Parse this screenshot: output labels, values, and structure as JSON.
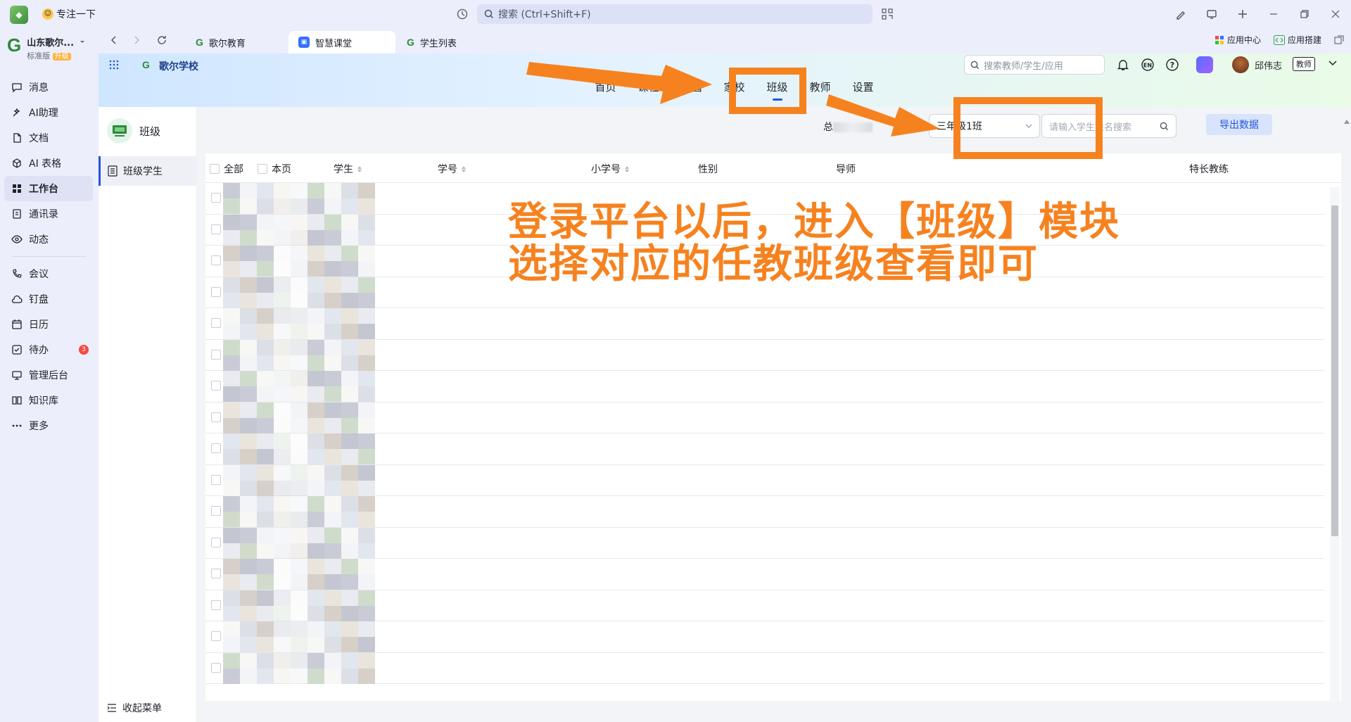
{
  "titlebar": {
    "app_icon": "app-icon",
    "focus_label": "专注一下",
    "search_placeholder": "搜索 (Ctrl+Shift+F)"
  },
  "rail": {
    "org_name": "山东歌尔...",
    "org_edition": "标准版",
    "org_upgrade": "升级",
    "items": [
      {
        "label": "消息",
        "icon": "chat-bubble-icon"
      },
      {
        "label": "AI助理",
        "icon": "sparkle-icon"
      },
      {
        "label": "文档",
        "icon": "document-icon"
      },
      {
        "label": "AI 表格",
        "icon": "table-icon"
      },
      {
        "label": "工作台",
        "icon": "grid-icon",
        "active": true
      },
      {
        "label": "通讯录",
        "icon": "contacts-icon"
      },
      {
        "label": "动态",
        "icon": "eye-icon"
      },
      {
        "label": "会议",
        "icon": "phone-icon"
      },
      {
        "label": "钉盘",
        "icon": "cloud-icon"
      },
      {
        "label": "日历",
        "icon": "calendar-icon"
      },
      {
        "label": "待办",
        "icon": "checkbox-icon",
        "badge": "3"
      },
      {
        "label": "管理后台",
        "icon": "monitor-icon"
      },
      {
        "label": "知识库",
        "icon": "book-icon"
      },
      {
        "label": "更多",
        "icon": "more-icon"
      }
    ]
  },
  "tabs": [
    {
      "label": "歌尔教育",
      "icon": "g-logo-icon"
    },
    {
      "label": "智慧课堂",
      "icon": "classroom-icon",
      "active": true
    },
    {
      "label": "学生列表",
      "icon": "g-logo-icon"
    }
  ],
  "tabs_right": {
    "app_center": "应用中心",
    "app_builder": "应用搭建"
  },
  "header": {
    "school_name": "歌尔学校",
    "search_placeholder": "搜索教师/学生/应用",
    "user_name": "邱伟志",
    "user_role": "教师"
  },
  "main_nav": [
    {
      "label": "首页"
    },
    {
      "label": "课程"
    },
    {
      "label": "校园"
    },
    {
      "label": "家校"
    },
    {
      "label": "班级",
      "active": true
    },
    {
      "label": "教师"
    },
    {
      "label": "设置"
    }
  ],
  "side": {
    "title": "班级",
    "item": "班级学生",
    "collapse": "收起菜单"
  },
  "toolbar": {
    "total_prefix": "总",
    "class_select": "三年级1班",
    "student_search_placeholder": "请输入学生姓名搜索",
    "export_label": "导出数据"
  },
  "table": {
    "columns": [
      "全部",
      "本页",
      "学生",
      "学号",
      "小学号",
      "性别",
      "导师",
      "特长教练"
    ],
    "row_count": 16,
    "partial_name": "张*"
  },
  "annotation": {
    "line1": "登录平台以后，进入【班级】模块",
    "line2": "选择对应的任教班级查看即可",
    "color": "#f6821f"
  }
}
